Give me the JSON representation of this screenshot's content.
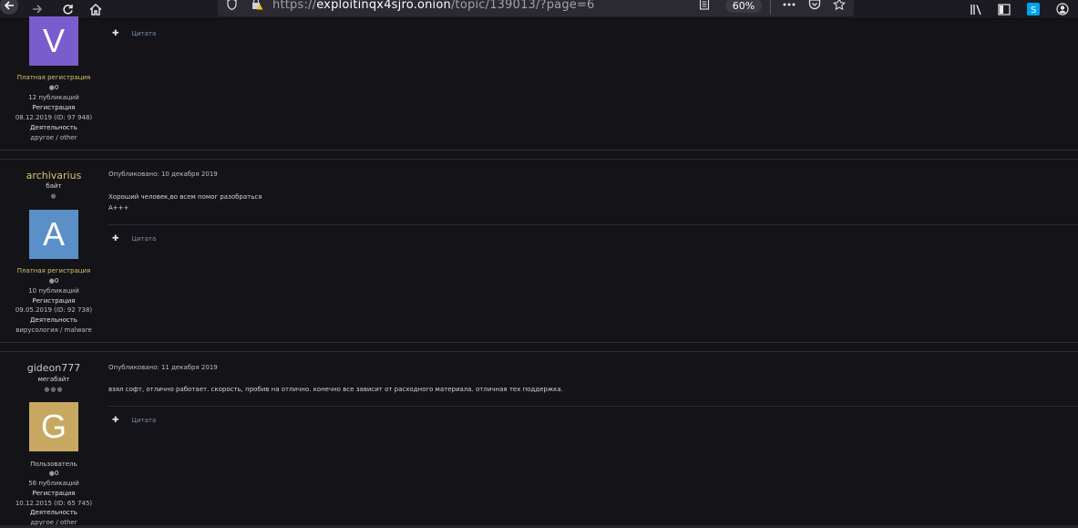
{
  "browser": {
    "url_prefix": "https://",
    "url_host": "exploitinqx4sjro.onion",
    "url_path": "/topic/139013/?page=6",
    "zoom": "60%"
  },
  "icons": {
    "back": "arrow-left-icon",
    "forward": "arrow-right-icon",
    "reload": "reload-icon",
    "home": "home-icon",
    "shield": "shield-icon",
    "warning": "warning-lock-icon",
    "reader": "reader-view-icon",
    "more": "ellipsis-icon",
    "pocket": "pocket-icon",
    "bookmark": "star-icon",
    "library": "library-icon",
    "sidebar": "sidebar-icon",
    "skype": "skype-icon",
    "account": "account-icon"
  },
  "posts": [
    {
      "avatar_letter": "V",
      "role": "Платная регистрация",
      "rep": "0",
      "posts_count": "12 публикаций",
      "reg_label": "Регистрация",
      "reg_value": "08.12.2019 (ID: 97 948)",
      "activity_label": "Деятельность",
      "activity_value": "другое / other",
      "quote_label": "Цитата"
    },
    {
      "username": "archivarius",
      "rank": "байт",
      "avatar_letter": "A",
      "role": "Платная регистрация",
      "rep": "0",
      "posts_count": "10 публикаций",
      "reg_label": "Регистрация",
      "reg_value": "09.05.2019 (ID: 92 738)",
      "activity_label": "Деятельность",
      "activity_value": "вирусология / malware",
      "published": "Опубликовано: 10 декабря 2019",
      "body": "Хороший человек,во всем помог разобраться\nA+++",
      "quote_label": "Цитата"
    },
    {
      "username": "gideon777",
      "rank": "мегабайт",
      "avatar_letter": "G",
      "role": "Пользователь",
      "rep": "0",
      "posts_count": "56 публикаций",
      "reg_label": "Регистрация",
      "reg_value": "10.12.2015 (ID: 65 745)",
      "activity_label": "Деятельность",
      "activity_value": "другое / other",
      "published": "Опубликовано: 11 декабря 2019",
      "body": "взял софт, отлично работает. скорость, пробив на отлично. конечно все зависит от расходного материала. отличная тех поддержка.",
      "quote_label": "Цитата"
    }
  ],
  "colors": {
    "avatar_v": "#7a5ccc",
    "avatar_a": "#5b8fc7",
    "avatar_g": "#c8a860",
    "gold": "#d6c36e"
  }
}
